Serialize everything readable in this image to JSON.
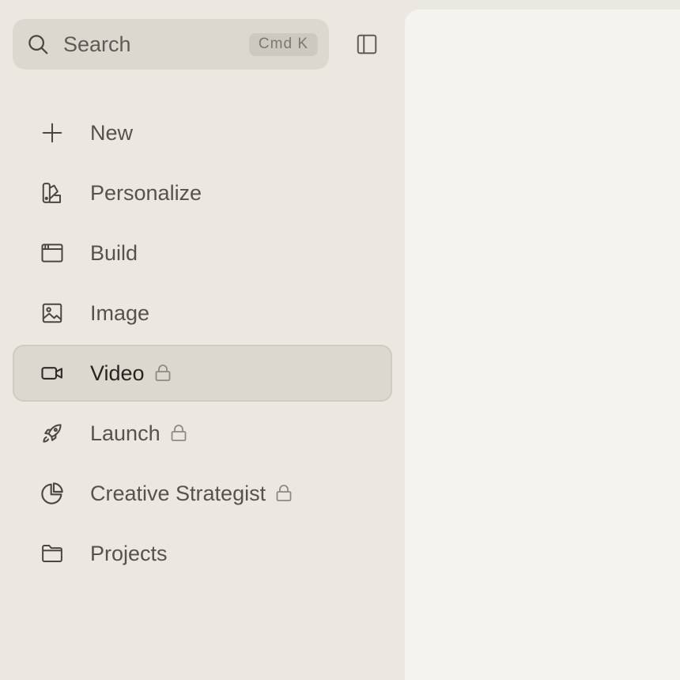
{
  "search": {
    "placeholder": "Search",
    "shortcut": "Cmd K",
    "icon": "search-icon"
  },
  "sidebar_toggle": {
    "icon": "sidebar-panel-icon"
  },
  "nav": {
    "items": [
      {
        "label": "New",
        "icon": "plus-icon",
        "locked": false,
        "active": false
      },
      {
        "label": "Personalize",
        "icon": "swatch-palette-icon",
        "locked": false,
        "active": false
      },
      {
        "label": "Build",
        "icon": "browser-window-icon",
        "locked": false,
        "active": false
      },
      {
        "label": "Image",
        "icon": "image-icon",
        "locked": false,
        "active": false
      },
      {
        "label": "Video",
        "icon": "video-camera-icon",
        "locked": true,
        "active": true
      },
      {
        "label": "Launch",
        "icon": "rocket-icon",
        "locked": true,
        "active": false
      },
      {
        "label": "Creative Strategist",
        "icon": "pie-chart-icon",
        "locked": true,
        "active": false
      },
      {
        "label": "Projects",
        "icon": "folder-icon",
        "locked": false,
        "active": false
      }
    ]
  },
  "colors": {
    "sidebar_bg": "#ebe8e1",
    "active_bg": "#dcd8d0",
    "main_bg": "#f4f3ef",
    "text": "#56524c",
    "icon_stroke": "#4a4741"
  }
}
